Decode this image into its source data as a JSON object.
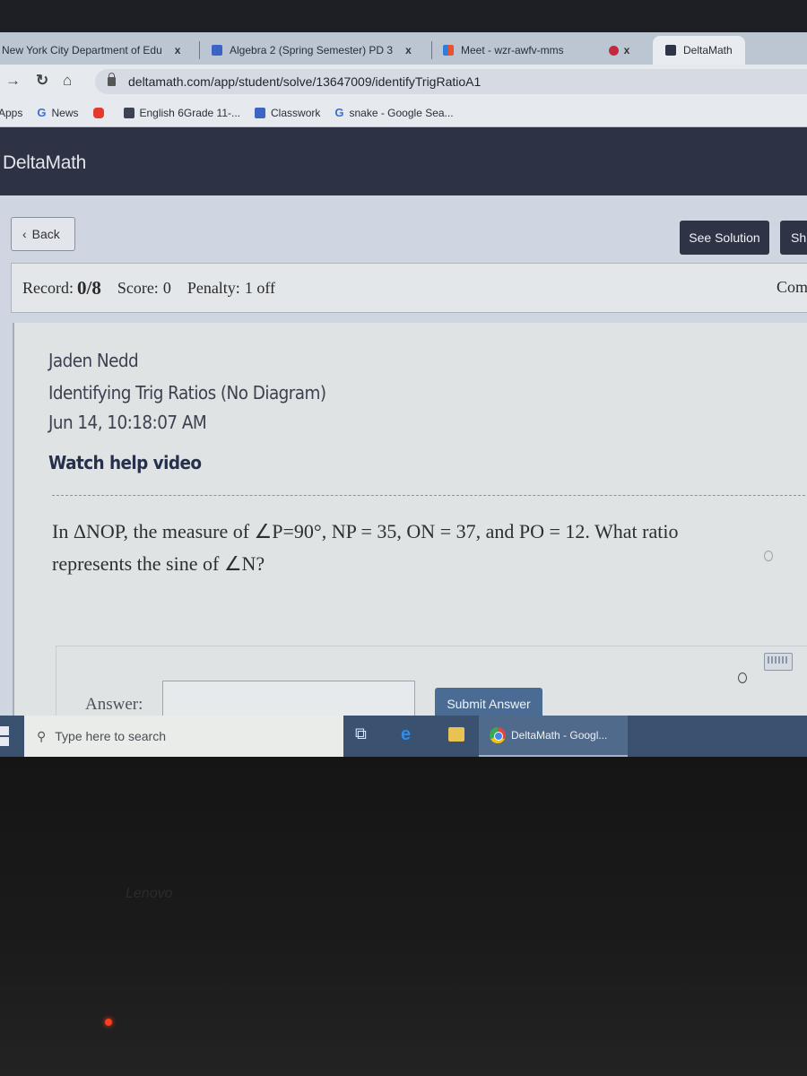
{
  "browser": {
    "tabs": [
      {
        "title": "New York City Department of Edu",
        "close": "x",
        "active": false
      },
      {
        "title": "Algebra 2 (Spring Semester) PD 3",
        "close": "x",
        "active": false
      },
      {
        "title": "Meet - wzr-awfv-mms",
        "close": "x",
        "active": false
      },
      {
        "title": "DeltaMath",
        "active": true
      }
    ],
    "url": "deltamath.com/app/student/solve/13647009/identifyTrigRatioA1",
    "bookmarks": [
      {
        "label": "Apps"
      },
      {
        "label": "News"
      },
      {
        "label": "English 6Grade 11-..."
      },
      {
        "label": "Classwork"
      },
      {
        "label": "snake - Google Sea..."
      }
    ]
  },
  "app": {
    "logo": "DeltaMath",
    "back_label": "Back",
    "see_solution_label": "See Solution",
    "show_label_partial": "Sh",
    "record": {
      "record_label": "Record:",
      "record_value": "0/8",
      "score_label": "Score:",
      "score_value": "0",
      "penalty_label": "Penalty:",
      "penalty_value": "1 off",
      "right_partial": "Com"
    },
    "student_name": "Jaden Nedd",
    "assignment_title": "Identifying Trig Ratios (No Diagram)",
    "timestamp": "Jun 14, 10:18:07 AM",
    "help_video_label": "Watch help video",
    "question_line1": "In ΔNOP, the measure of ∠P=90°, NP = 35, ON = 37, and PO = 12. What ratio",
    "question_line2": "represents the sine of ∠N?",
    "answer_label": "Answer:",
    "answer_value": "",
    "submit_label": "Submit Answer"
  },
  "taskbar": {
    "search_placeholder": "Type here to search",
    "chrome_window_label": "DeltaMath - Googl..."
  },
  "device": {
    "brand": "Lenovo"
  }
}
